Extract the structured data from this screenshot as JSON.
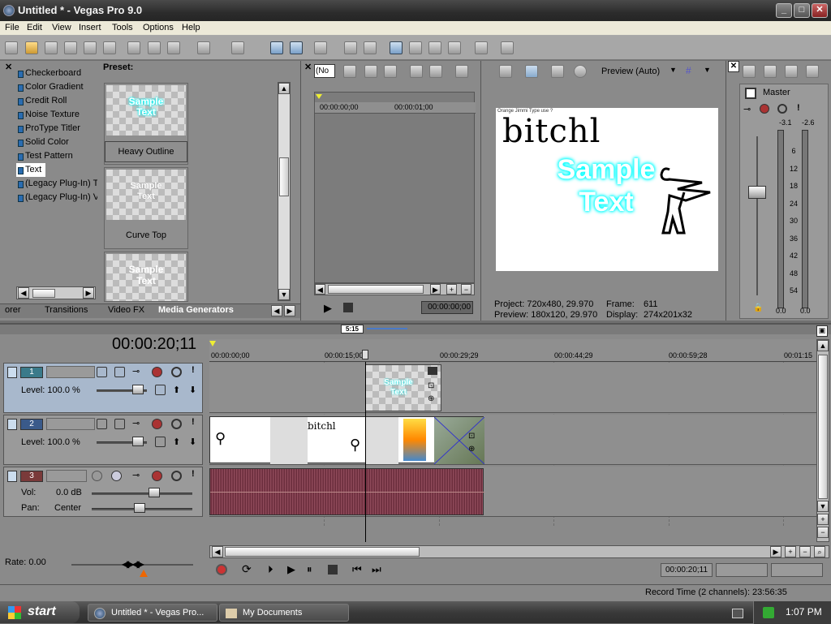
{
  "window": {
    "title": "Untitled * - Vegas Pro 9.0",
    "min_glyph": "_",
    "max_glyph": "□",
    "close_glyph": "✕"
  },
  "menu": [
    "File",
    "Edit",
    "View",
    "Insert",
    "Tools",
    "Options",
    "Help"
  ],
  "explorer": {
    "items": [
      "Checkerboard",
      "Color Gradient",
      "Credit Roll",
      "Noise Texture",
      "ProType Titler",
      "Solid Color",
      "Test Pattern",
      "Text",
      "(Legacy Plug-In) T",
      "(Legacy Plug-In) V"
    ],
    "selected": "Text",
    "preset_label": "Preset:",
    "presets": [
      {
        "thumb_text_line1": "Sample",
        "thumb_text_line2": "Text",
        "label": "Heavy Outline"
      },
      {
        "thumb_text_line1": "Sample",
        "thumb_text_line2": "Text",
        "label": "Curve Top"
      },
      {
        "thumb_text_line1": "Sample",
        "thumb_text_line2": "Text",
        "label": ""
      }
    ],
    "tabs": [
      "orer",
      "Transitions",
      "Video FX",
      "Media Generators"
    ],
    "active_tab": "Media Generators"
  },
  "trimmer": {
    "dropdown": "(No",
    "time_start": "00:00:00;00",
    "time_mid": "00:00:01;00",
    "timecode": "00:00:00;00"
  },
  "preview": {
    "mode": "Preview (Auto)",
    "scribble_header": "Orange Jimmi  Type use ?",
    "handwritten": "bitchl",
    "sample_line1": "Sample",
    "sample_line2": "Text",
    "project_label": "Project:",
    "project_value": "720x480, 29.970",
    "frame_label": "Frame:",
    "frame_value": "611",
    "preview_label": "Preview:",
    "preview_value": "180x120, 29.970",
    "display_label": "Display:",
    "display_value": "274x201x32"
  },
  "mixer": {
    "title": "Master",
    "peak_left": "-3.1",
    "peak_right": "-2.6",
    "scale": [
      "6",
      "12",
      "18",
      "24",
      "30",
      "36",
      "42",
      "48",
      "54"
    ],
    "bottom_left": "0.0",
    "bottom_right": "0.0"
  },
  "timeline": {
    "timecode": "00:00:20;11",
    "loop_region": "5:15",
    "ruler": [
      "00:00:00;00",
      "00:00:15;00",
      "00:00:29;29",
      "00:00:44;29",
      "00:00:59;28",
      "00:01:15"
    ],
    "tracks": [
      {
        "num": "1",
        "level_label": "Level: 100.0 %"
      },
      {
        "num": "2",
        "level_label": "Level: 100.0 %"
      },
      {
        "num": "3",
        "vol_label": "Vol:",
        "vol_value": "0.0 dB",
        "pan_label": "Pan:",
        "pan_value": "Center"
      }
    ],
    "clip_text_line1": "Sample",
    "clip_text_line2": "Text",
    "clip_scribble": "bitchl",
    "rate": "Rate: 0.00",
    "transport_time": "00:00:20;11",
    "record_time": "Record Time (2 channels): 23:56:35"
  },
  "taskbar": {
    "start": "start",
    "items": [
      "Untitled * - Vegas Pro...",
      "My Documents"
    ],
    "clock": "1:07 PM"
  },
  "colors": {
    "accent": "#2a6cb0",
    "selected_track": "#a8b8cc",
    "audio_wave": "#7a3a4a",
    "sample_text": "#6ff"
  }
}
